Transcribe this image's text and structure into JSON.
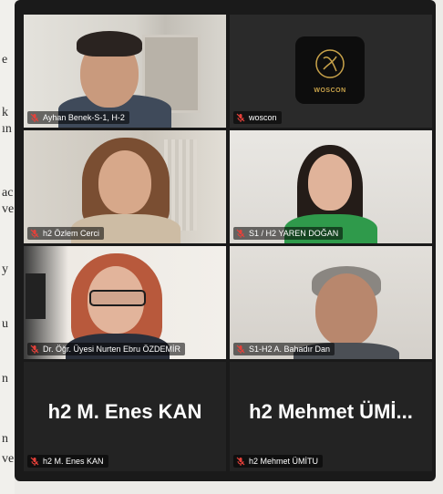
{
  "background_document": {
    "visible_chars": [
      "e",
      "k",
      "ın",
      "ac",
      "ve",
      "y",
      "u",
      "n",
      "n",
      "ve"
    ]
  },
  "participants": [
    {
      "name": "Ayhan Benek-S-1, H-2",
      "active_speaker": true,
      "muted": true
    },
    {
      "name": "woscon",
      "muted": true,
      "logo_text": "WOSCON"
    },
    {
      "name": "h2 Özlem Cerci",
      "muted": true
    },
    {
      "name": "S1 / H2 YAREN DOĞAN",
      "muted": true
    },
    {
      "name": "Dr. Öğr. Üyesi Nurten Ebru ÖZDEMİR",
      "muted": true
    },
    {
      "name": "S1-H2 A. Bahadır Dan",
      "muted": true
    },
    {
      "name": "h2 M. Enes KAN",
      "display_name": "h2 M. Enes KAN",
      "muted": true
    },
    {
      "name": "h2 Mehmet ÜMİTU",
      "display_name": "h2 Mehmet ÜMİ...",
      "muted": true
    }
  ],
  "colors": {
    "active_border": "#27c75a",
    "muted_icon": "#e5413a",
    "window_bg": "#1a1a1a"
  }
}
